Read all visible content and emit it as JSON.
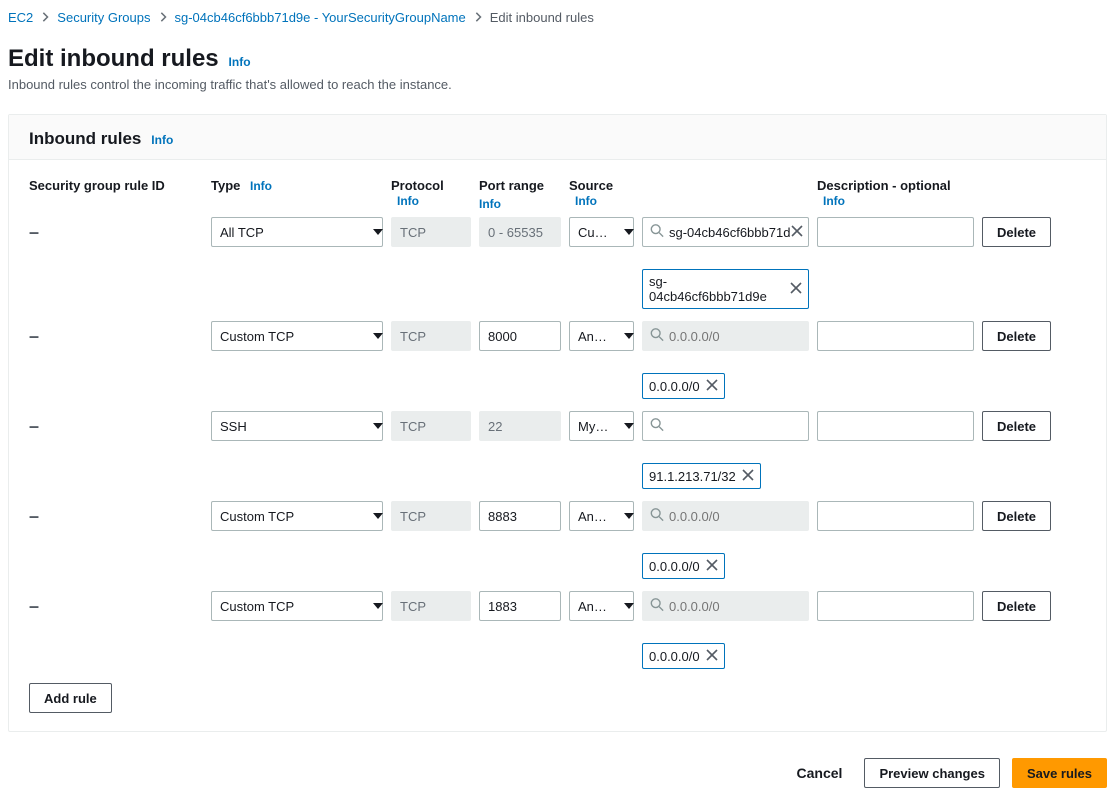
{
  "breadcrumb": {
    "items": [
      {
        "label": "EC2"
      },
      {
        "label": "Security Groups"
      },
      {
        "label": "sg-04cb46cf6bbb71d9e - YourSecurityGroupName"
      }
    ],
    "current": "Edit inbound rules"
  },
  "page": {
    "title": "Edit inbound rules",
    "info": "Info",
    "description": "Inbound rules control the incoming traffic that's allowed to reach the instance."
  },
  "panel": {
    "title": "Inbound rules",
    "info": "Info"
  },
  "columns": {
    "rule_id": "Security group rule ID",
    "type": "Type",
    "protocol": "Protocol",
    "port_range": "Port range",
    "source": "Source",
    "description": "Description - optional",
    "info": "Info"
  },
  "rules": [
    {
      "rule_id": "–",
      "type": "All TCP",
      "protocol": "TCP",
      "protocol_disabled": true,
      "port_range": "0 - 65535",
      "port_range_disabled": true,
      "source_mode": "Custom",
      "source_search": "sg-04cb46cf6bbb71d",
      "source_search_has_value": true,
      "source_placeholder": "",
      "source_tags": [
        "sg-04cb46cf6bbb71d9e"
      ],
      "description": ""
    },
    {
      "rule_id": "–",
      "type": "Custom TCP",
      "protocol": "TCP",
      "protocol_disabled": true,
      "port_range": "8000",
      "port_range_disabled": false,
      "source_mode": "Anyw...",
      "source_search": "",
      "source_search_has_value": false,
      "source_placeholder": "0.0.0.0/0",
      "source_tags": [
        "0.0.0.0/0"
      ],
      "description": ""
    },
    {
      "rule_id": "–",
      "type": "SSH",
      "protocol": "TCP",
      "protocol_disabled": true,
      "port_range": "22",
      "port_range_disabled": true,
      "source_mode": "My IP",
      "source_search": "",
      "source_search_has_value": false,
      "source_placeholder": "",
      "source_tags": [
        "91.1.213.71/32"
      ],
      "description": ""
    },
    {
      "rule_id": "–",
      "type": "Custom TCP",
      "protocol": "TCP",
      "protocol_disabled": true,
      "port_range": "8883",
      "port_range_disabled": false,
      "source_mode": "Anyw...",
      "source_search": "",
      "source_search_has_value": false,
      "source_placeholder": "0.0.0.0/0",
      "source_tags": [
        "0.0.0.0/0"
      ],
      "description": ""
    },
    {
      "rule_id": "–",
      "type": "Custom TCP",
      "protocol": "TCP",
      "protocol_disabled": true,
      "port_range": "1883",
      "port_range_disabled": false,
      "source_mode": "Anyw...",
      "source_search": "",
      "source_search_has_value": false,
      "source_placeholder": "0.0.0.0/0",
      "source_tags": [
        "0.0.0.0/0"
      ],
      "description": ""
    }
  ],
  "buttons": {
    "delete": "Delete",
    "add_rule": "Add rule",
    "cancel": "Cancel",
    "preview": "Preview changes",
    "save": "Save rules"
  }
}
